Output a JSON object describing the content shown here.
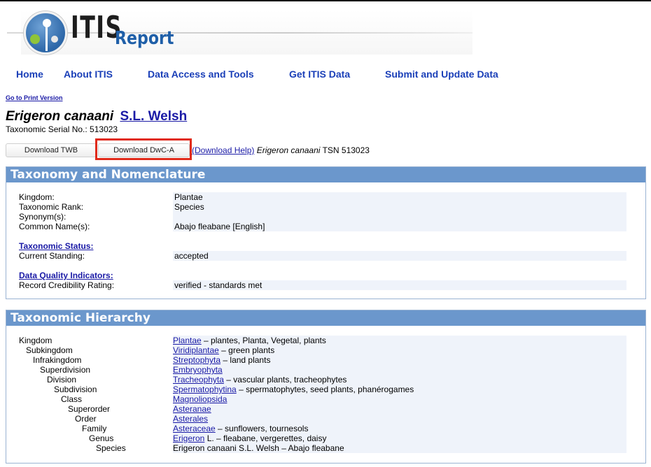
{
  "header": {
    "logo_text": "ITIS",
    "report_label": "Report"
  },
  "nav": [
    "Home",
    "About ITIS",
    "Data Access and Tools",
    "Get ITIS Data",
    "Submit and Update Data"
  ],
  "print_link": "Go to Print Version",
  "record": {
    "scientific_name": "Erigeron canaani",
    "author": "S.L. Welsh",
    "tsn_label": "Taxonomic Serial No.: 513023"
  },
  "downloads": {
    "twb_button": "Download TWB",
    "dwca_button": "Download DwC-A",
    "help_link": "(Download Help)",
    "name": "Erigeron canaani",
    "tsn_text": "TSN 513023"
  },
  "taxonomy": {
    "title": "Taxonomy and Nomenclature",
    "rows": [
      {
        "label": "Kingdom:",
        "value": "Plantae"
      },
      {
        "label": "Taxonomic Rank:",
        "value": "Species"
      },
      {
        "label": "Synonym(s):",
        "value": ""
      },
      {
        "label": "Common Name(s):",
        "value": "Abajo fleabane [English]"
      }
    ],
    "status_link": "Taxonomic Status:",
    "standing_label": "Current Standing:",
    "standing_value": "accepted",
    "dq_link": "Data Quality Indicators:",
    "credibility_label": "Record Credibility Rating:",
    "credibility_value": "verified - standards met"
  },
  "hierarchy": {
    "title": "Taxonomic Hierarchy",
    "rows": [
      {
        "rank": "Kingdom",
        "name": "Plantae",
        "rest": "– plantes, Planta, Vegetal, plants"
      },
      {
        "rank": "Subkingdom",
        "name": "Viridiplantae",
        "rest": "– green plants"
      },
      {
        "rank": "Infrakingdom",
        "name": "Streptophyta",
        "rest": "– land plants"
      },
      {
        "rank": "Superdivision",
        "name": "Embryophyta",
        "rest": ""
      },
      {
        "rank": "Division",
        "name": "Tracheophyta",
        "rest": "– vascular plants, tracheophytes"
      },
      {
        "rank": "Subdivision",
        "name": "Spermatophytina",
        "rest": "– spermatophytes, seed plants, phanérogames"
      },
      {
        "rank": "Class",
        "name": "Magnoliopsida",
        "rest": ""
      },
      {
        "rank": "Superorder",
        "name": "Asteranae",
        "rest": ""
      },
      {
        "rank": "Order",
        "name": "Asterales",
        "rest": ""
      },
      {
        "rank": "Family",
        "name": "Asteraceae",
        "rest": "– sunflowers, tournesols"
      },
      {
        "rank": "Genus",
        "name": "Erigeron",
        "rest": "L. – fleabane, vergerettes, daisy"
      },
      {
        "rank": "Species",
        "name": "",
        "rest": "Erigeron canaani S.L. Welsh – Abajo fleabane"
      }
    ]
  },
  "colors": {
    "panel_header": "#6b97cc",
    "link": "#1a1aa6",
    "nav_link": "#1a3fb8",
    "highlight": "#e02a1a",
    "value_bg": "#eff3fa"
  }
}
